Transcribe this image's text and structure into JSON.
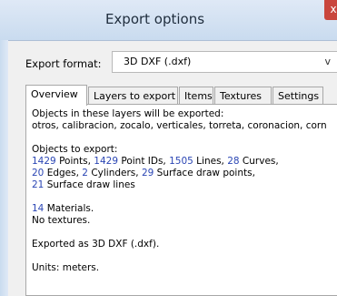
{
  "window": {
    "title": "Export options",
    "close_glyph": "x"
  },
  "export_format": {
    "label": "Export format:",
    "value": "3D DXF (.dxf)",
    "chevron": "v"
  },
  "tabs": [
    {
      "label": "Overview",
      "active": true
    },
    {
      "label": "Layers to export",
      "active": false
    },
    {
      "label": "Items",
      "active": false
    },
    {
      "label": "Textures",
      "active": false
    },
    {
      "label": "Settings",
      "active": false
    }
  ],
  "overview": {
    "layers_heading": "Objects in these layers will be exported:",
    "layers_list": "otros, calibracion, zocalo, verticales, torreta, coronacion, corn",
    "objects_heading": "Objects to export:",
    "points_count": "1429",
    "points_label": " Points, ",
    "point_ids_count": "1429",
    "point_ids_label": " Point IDs, ",
    "lines_count": "1505",
    "lines_label": " Lines, ",
    "curves_count": "28",
    "curves_label": " Curves,",
    "edges_count": "20",
    "edges_label": " Edges, ",
    "cylinders_count": "2",
    "cylinders_label": " Cylinders, ",
    "surface_points_count": "29",
    "surface_points_label": " Surface draw points,",
    "surface_lines_count": "21",
    "surface_lines_label": " Surface draw lines",
    "materials_count": "14",
    "materials_label": " Materials.",
    "textures_line": "No textures.",
    "exported_as": "Exported as 3D DXF (.dxf).",
    "units": "Units: meters."
  },
  "colors": {
    "number": "#2b46b4",
    "close": "#c9463d"
  }
}
